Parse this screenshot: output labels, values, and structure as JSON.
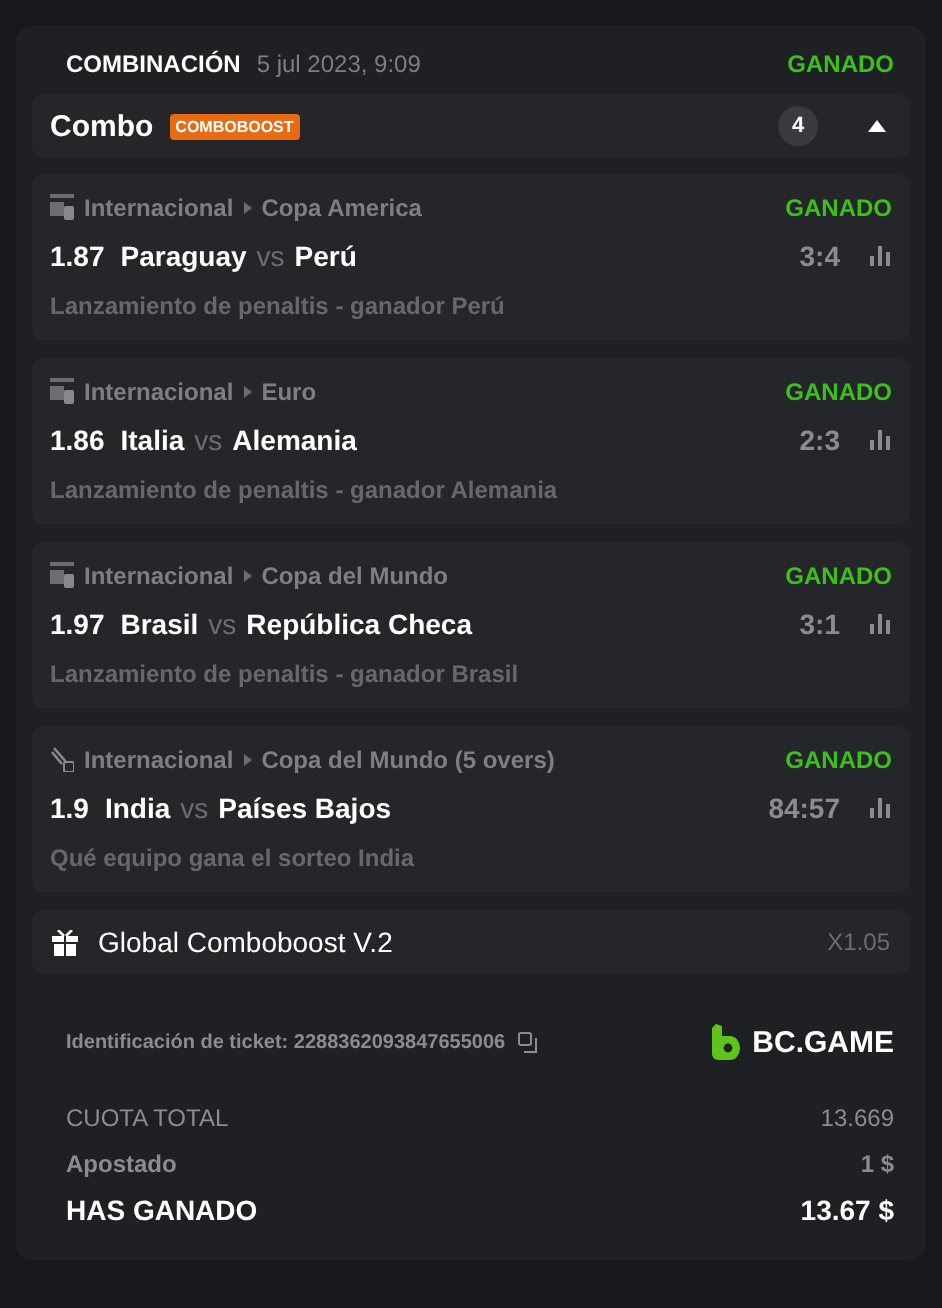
{
  "header": {
    "type": "COMBINACIÓN",
    "date": "5 jul 2023, 9:09",
    "status": "GANADO"
  },
  "combo": {
    "title": "Combo",
    "badge": "COMBOBOOST",
    "count": "4",
    "expanded": true
  },
  "legs": [
    {
      "kind": "fifa",
      "category": "Internacional",
      "league": "Copa America",
      "status": "GANADO",
      "odds": "1.87",
      "home": "Paraguay",
      "vs": "vs",
      "away": "Perú",
      "score": "3:4",
      "market": "Lanzamiento de penaltis - ganador Perú"
    },
    {
      "kind": "fifa",
      "category": "Internacional",
      "league": "Euro",
      "status": "GANADO",
      "odds": "1.86",
      "home": "Italia",
      "vs": "vs",
      "away": "Alemania",
      "score": "2:3",
      "market": "Lanzamiento de penaltis - ganador Alemania"
    },
    {
      "kind": "fifa",
      "category": "Internacional",
      "league": "Copa del Mundo",
      "status": "GANADO",
      "odds": "1.97",
      "home": "Brasil",
      "vs": "vs",
      "away": "República Checa",
      "score": "3:1",
      "market": "Lanzamiento de penaltis - ganador Brasil"
    },
    {
      "kind": "cricket",
      "category": "Internacional",
      "league": "Copa del Mundo (5 overs)",
      "status": "GANADO",
      "odds": "1.9",
      "home": "India",
      "vs": "vs",
      "away": "Países Bajos",
      "score": "84:57",
      "market": "Qué equipo gana el sorteo India"
    }
  ],
  "boost": {
    "label": "Global Comboboost V.2",
    "multiplier": "X1.05"
  },
  "ticket": {
    "label": "Identificación de ticket: 2288362093847655006",
    "brand": "BC.GAME"
  },
  "totals": [
    {
      "kind": "plain",
      "label": "CUOTA TOTAL",
      "value": "13.669"
    },
    {
      "kind": "muted",
      "label": "Apostado",
      "value": "1 $"
    },
    {
      "kind": "strong",
      "label": "HAS GANADO",
      "value": "13.67 $"
    }
  ]
}
